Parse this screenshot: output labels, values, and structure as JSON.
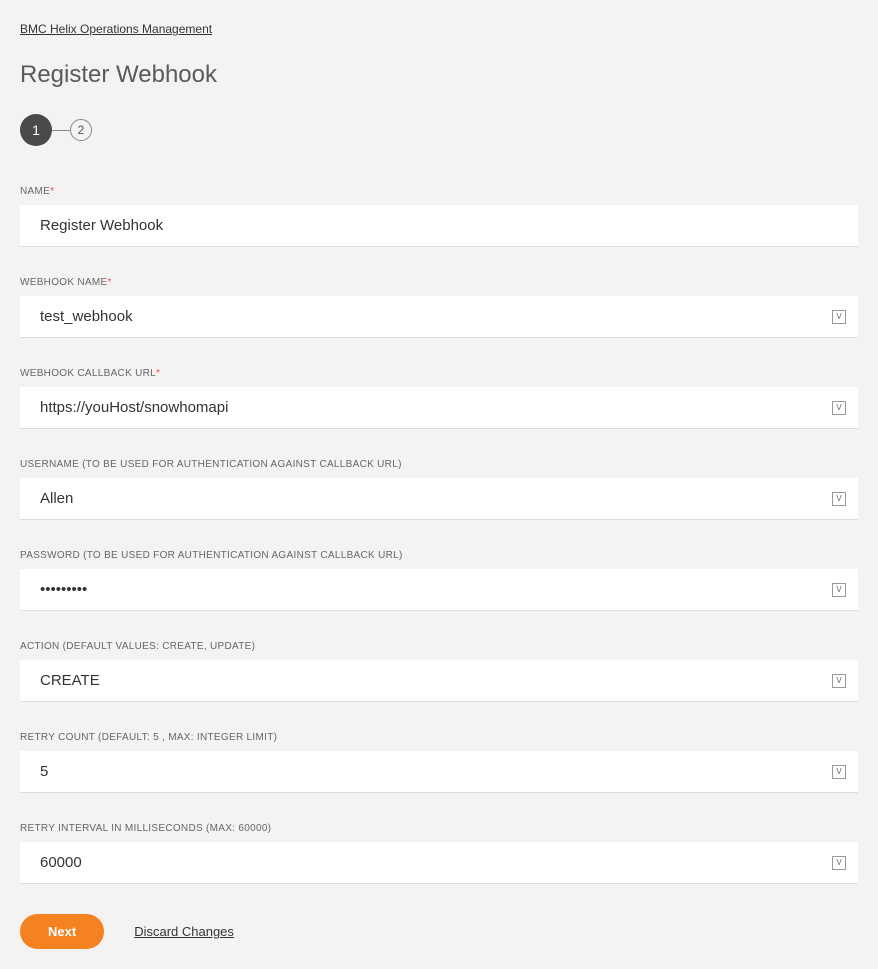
{
  "breadcrumb": "BMC Helix Operations Management",
  "page_title": "Register Webhook",
  "stepper": {
    "step1": "1",
    "step2": "2"
  },
  "fields": {
    "name": {
      "label": "NAME",
      "required": true,
      "value": "Register Webhook",
      "has_badge": false
    },
    "webhook_name": {
      "label": "WEBHOOK NAME",
      "required": true,
      "value": "test_webhook",
      "badge": "V"
    },
    "callback_url": {
      "label": "WEBHOOK CALLBACK URL",
      "required": true,
      "value": "https://youHost/snowhomapi",
      "badge": "V"
    },
    "username": {
      "label": "USERNAME (TO BE USED FOR AUTHENTICATION AGAINST CALLBACK URL)",
      "required": false,
      "value": "Allen",
      "badge": "V"
    },
    "password": {
      "label": "PASSWORD (TO BE USED FOR AUTHENTICATION AGAINST CALLBACK URL)",
      "required": false,
      "value": "•••••••••",
      "badge": "V"
    },
    "action": {
      "label": "ACTION (DEFAULT VALUES: CREATE, UPDATE)",
      "required": false,
      "value": "CREATE",
      "badge": "V"
    },
    "retry_count": {
      "label": "RETRY COUNT (DEFAULT: 5 , MAX: INTEGER LIMIT)",
      "required": false,
      "value": "5",
      "badge": "V"
    },
    "retry_interval": {
      "label": "RETRY INTERVAL IN MILLISECONDS (MAX: 60000)",
      "required": false,
      "value": "60000",
      "badge": "V"
    }
  },
  "buttons": {
    "next": "Next",
    "discard": "Discard Changes"
  }
}
